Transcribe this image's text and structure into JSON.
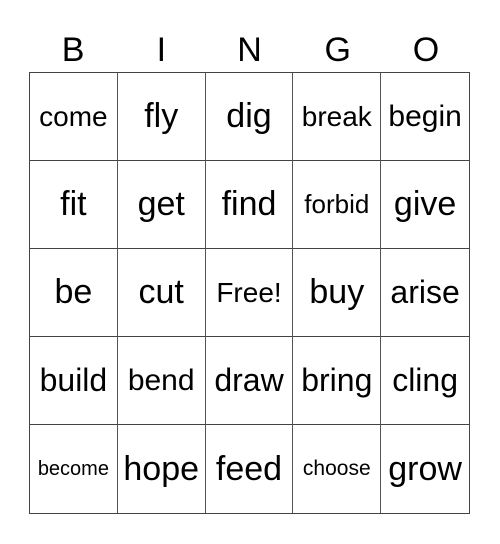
{
  "title_letters": [
    "B",
    "I",
    "N",
    "G",
    "O"
  ],
  "rows": [
    [
      "come",
      "fly",
      "dig",
      "break",
      "begin"
    ],
    [
      "fit",
      "get",
      "find",
      "forbid",
      "give"
    ],
    [
      "be",
      "cut",
      "Free!",
      "buy",
      "arise"
    ],
    [
      "build",
      "bend",
      "draw",
      "bring",
      "cling"
    ],
    [
      "become",
      "hope",
      "feed",
      "choose",
      "grow"
    ]
  ]
}
